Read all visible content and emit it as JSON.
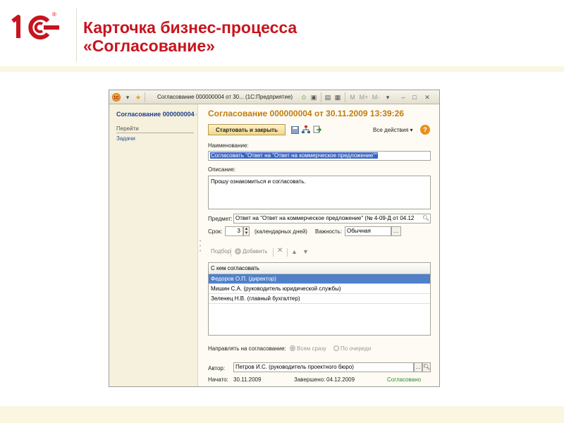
{
  "slide": {
    "title_line1": "Карточка бизнес-процесса",
    "title_line2": "«Согласование»",
    "logo_text": "1С",
    "logo_mark": "®"
  },
  "window": {
    "title": "Согласование 000000004 от 30... (1С:Предприятие)",
    "controls": {
      "m": "M",
      "mplus": "M+",
      "mminus": "M-"
    }
  },
  "sidebar": {
    "title": "Согласование 000000004 от 30.11.2009 13:39:26",
    "group": "Перейти",
    "link": "Задачи"
  },
  "form": {
    "doc_title": "Согласование 000000004 от 30.11.2009 13:39:26",
    "start_button": "Стартовать и закрыть",
    "all_actions": "Все действия",
    "help": "?",
    "name_label": "Наименование:",
    "name_value": "Согласовать \"Ответ на \"Ответ на коммерческое предложение\"\"",
    "desc_label": "Описание:",
    "desc_value": "Прошу ознакомиться и согласовать.",
    "subject_label": "Предмет:",
    "subject_value": "Ответ на \"Ответ на коммерческое предложение\" (№ 4-09-Д от 04.12",
    "term_label": "Срок:",
    "term_value": "3",
    "term_unit": "(календарных дней)",
    "importance_label": "Важность:",
    "importance_value": "Обычная",
    "pick_label": "Подбор",
    "add_label": "Добавить",
    "grid_header": "С кем согласовать",
    "grid_rows": [
      "Федоров О.П. (директор)",
      "Мишин С.А. (руководитель юридической службы)",
      "Зеленец Н.В. (главный бухгалтер)"
    ],
    "route_label": "Направлять на согласование:",
    "route_all": "Всем сразу",
    "route_queue": "По очереди",
    "author_label": "Автор:",
    "author_value": "Петров И.С. (руководитель проектного бюро)",
    "started_label": "Начато:",
    "started_value": "30.11.2009",
    "finished_label": "Завершено:",
    "finished_value": "04.12.2009",
    "status": "Согласовано"
  },
  "colors": {
    "accent_red": "#c8141e",
    "doc_title": "#c27c10",
    "selection": "#4f80c9",
    "status_green": "#2a8a2a"
  },
  "icons": [
    "logo-1c-icon",
    "star-icon",
    "arrow-back-icon",
    "arrow-forward-icon",
    "save-icon",
    "tree-icon",
    "refresh-icon",
    "search-icon",
    "plus-icon",
    "delete-icon",
    "arrow-up-icon",
    "arrow-down-icon"
  ]
}
